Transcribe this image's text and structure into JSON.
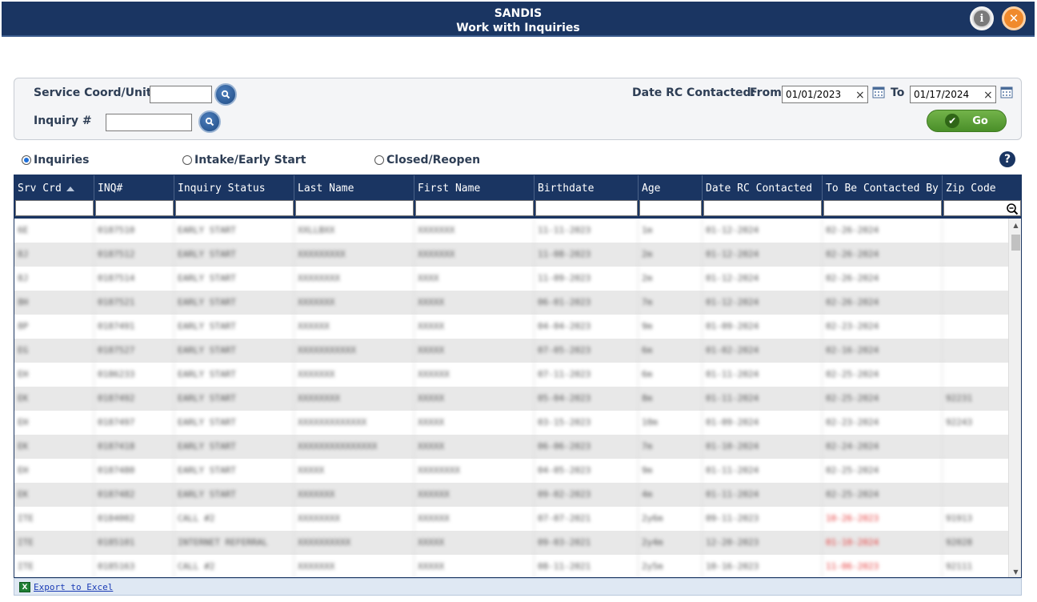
{
  "window": {
    "app_name": "SANDIS",
    "title": "Work with Inquiries",
    "info_glyph": "i",
    "close_glyph": "✕"
  },
  "filters": {
    "service_coord_label": "Service Coord/Unit",
    "service_coord_value": "",
    "inquiry_label": "Inquiry #",
    "inquiry_value": "",
    "date_label": "Date RC Contacted:",
    "from_label": "From",
    "from_value": "01/01/2023",
    "to_label": "To",
    "to_value": "01/17/2024",
    "go_label": "Go"
  },
  "views": [
    {
      "label": "Inquiries",
      "selected": true
    },
    {
      "label": "Intake/Early Start",
      "selected": false
    },
    {
      "label": "Closed/Reopen",
      "selected": false
    }
  ],
  "help_glyph": "?",
  "grid": {
    "columns": [
      "Srv Crd",
      "INQ#",
      "Inquiry Status",
      "Last Name",
      "First Name",
      "Birthdate",
      "Age",
      "Date RC Contacted",
      "To Be Contacted By",
      "Zip Code"
    ],
    "sort_column": "Srv Crd",
    "sort_direction": "ascending",
    "rows": [
      [
        "6E",
        "0187510",
        "EARLY START",
        "XXLLBXX",
        "XXXXXXX",
        "11-11-2023",
        "1m",
        "01-12-2024",
        "02-26-2024",
        ""
      ],
      [
        "8J",
        "0187512",
        "EARLY START",
        "XXXXXXXXX",
        "XXXXXXX",
        "11-08-2023",
        "2m",
        "01-12-2024",
        "02-26-2024",
        ""
      ],
      [
        "8J",
        "0187514",
        "EARLY START",
        "XXXXXXXX",
        "XXXX",
        "11-09-2023",
        "2m",
        "01-12-2024",
        "02-26-2024",
        ""
      ],
      [
        "8H",
        "0187521",
        "EARLY START",
        "XXXXXXX",
        "XXXXX",
        "06-01-2023",
        "7m",
        "01-12-2024",
        "02-26-2024",
        ""
      ],
      [
        "8P",
        "0187491",
        "EARLY START",
        "XXXXXX",
        "XXXXX",
        "04-04-2023",
        "9m",
        "01-09-2024",
        "02-23-2024",
        ""
      ],
      [
        "EG",
        "0187527",
        "EARLY START",
        "XXXXXXXXXXX",
        "XXXXX",
        "07-05-2023",
        "6m",
        "01-02-2024",
        "02-16-2024",
        ""
      ],
      [
        "EH",
        "0186233",
        "EARLY START",
        "XXXXXXX",
        "XXXXXX",
        "07-11-2023",
        "6m",
        "01-11-2024",
        "02-25-2024",
        ""
      ],
      [
        "EK",
        "0187492",
        "EARLY START",
        "XXXXXXXX",
        "XXXXX",
        "05-04-2023",
        "8m",
        "01-11-2024",
        "02-25-2024",
        "92231"
      ],
      [
        "EH",
        "0187497",
        "EARLY START",
        "XXXXXXXXXXXXX",
        "XXXXX",
        "03-15-2023",
        "10m",
        "01-09-2024",
        "02-23-2024",
        "92243"
      ],
      [
        "EK",
        "0187418",
        "EARLY START",
        "XXXXXXXXXXXXXXX",
        "XXXXX",
        "06-06-2023",
        "7m",
        "01-10-2024",
        "02-24-2024",
        ""
      ],
      [
        "EH",
        "0187480",
        "EARLY START",
        "XXXXX",
        "XXXXXXXX",
        "04-05-2023",
        "9m",
        "01-11-2024",
        "02-25-2024",
        ""
      ],
      [
        "EK",
        "0187482",
        "EARLY START",
        "XXXXXXX",
        "XXXXXX",
        "09-02-2023",
        "4m",
        "01-11-2024",
        "02-25-2024",
        ""
      ],
      [
        "ITE",
        "0184002",
        "CALL #2",
        "XXXXXXXX",
        "XXXXXX",
        "07-07-2021",
        "2y6m",
        "09-11-2023",
        "10-26-2023",
        "91913"
      ],
      [
        "ITE",
        "0185101",
        "INTERNET REFERRAL",
        "XXXXXXXXXX",
        "XXXXX",
        "09-03-2021",
        "2y4m",
        "12-20-2023",
        "01-10-2024",
        "92028"
      ],
      [
        "ITE",
        "0185163",
        "CALL #2",
        "XXXXXXX",
        "XXXXX",
        "08-11-2021",
        "2y5m",
        "10-16-2023",
        "11-06-2023",
        "92111"
      ]
    ],
    "overdue_rows": [
      12,
      13,
      14
    ]
  },
  "footer": {
    "export_label": "Export to Excel",
    "excel_glyph": "X"
  }
}
